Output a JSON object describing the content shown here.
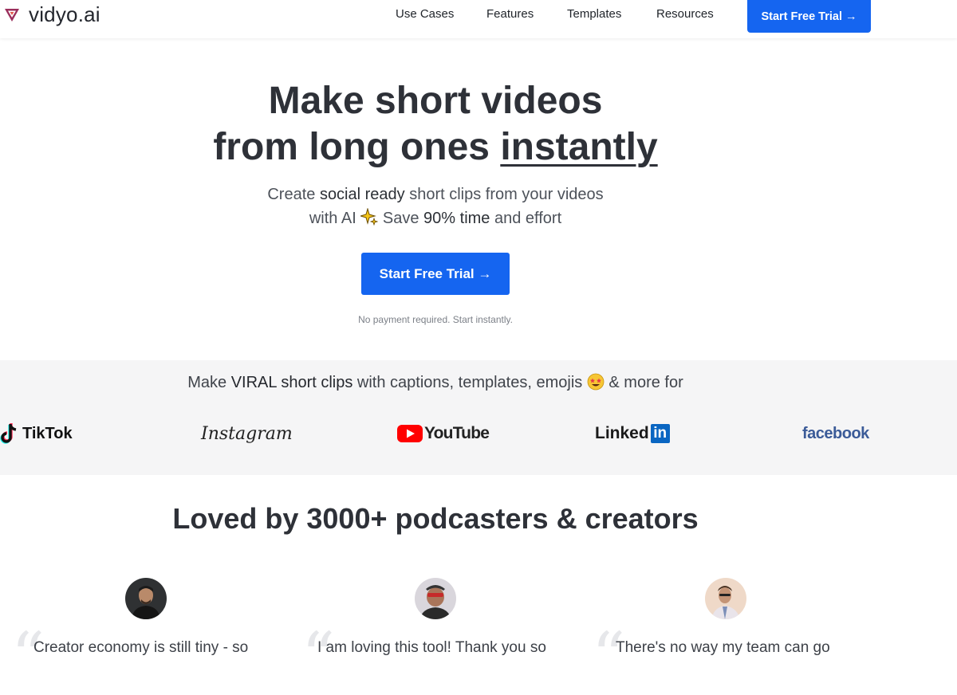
{
  "nav": {
    "brand": "vidyo.ai",
    "links": [
      "Use Cases",
      "Features",
      "Templates",
      "Resources"
    ],
    "cta": "Start Free Trial →"
  },
  "hero": {
    "title_line1": "Make short videos",
    "title_line2_prefix": "from long ones ",
    "title_line2_emphasis": "instantly",
    "subtitle_1a": "Create ",
    "subtitle_1b": "social ready",
    "subtitle_1c": " short clips from your videos",
    "subtitle_2a": "with AI ",
    "subtitle_2b": " Save ",
    "subtitle_2c": "90% time",
    "subtitle_2d": " and effort",
    "cta": "Start Free Trial →",
    "note": "No payment required. Start instantly."
  },
  "platforms": {
    "tagline_a": "Make ",
    "tagline_b": "VIRAL short clips",
    "tagline_c": " with captions, templates, emojis ",
    "tagline_d": " & more for",
    "names": {
      "tiktok": "TikTok",
      "instagram": "Instagram",
      "youtube": "YouTube",
      "linkedin_word": "Linked",
      "linkedin_box": "in",
      "facebook": "facebook"
    },
    "colors": {
      "youtube_red": "#ff0000",
      "linkedin_blue": "#0a66c2",
      "facebook_blue": "#3b5b98",
      "accent": "#1565f0"
    }
  },
  "testimonials": {
    "heading": "Loved by 3000+ podcasters & creators",
    "items": [
      {
        "quote": "Creator economy is still tiny - so"
      },
      {
        "quote": "I am loving this tool! Thank you so"
      },
      {
        "quote": "There's no way my team can go"
      }
    ]
  }
}
